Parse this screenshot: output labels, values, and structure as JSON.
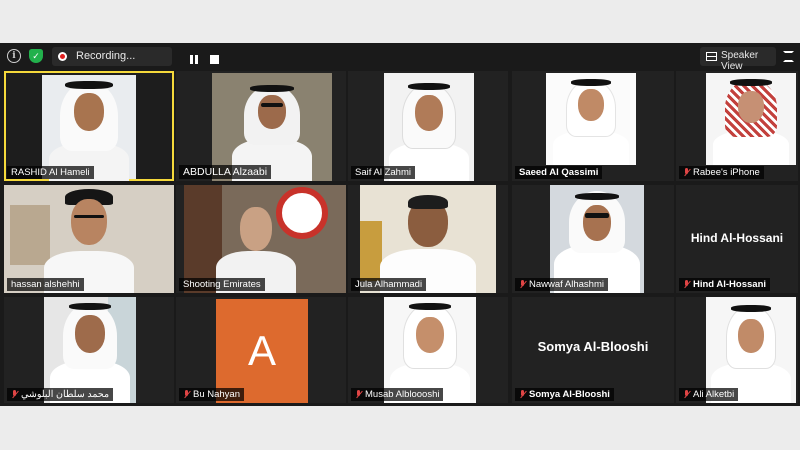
{
  "toolbar": {
    "recording_label": "Recording...",
    "speaker_view_label": "Speaker View",
    "icons": [
      "info-icon",
      "shield-icon",
      "record-icon",
      "pause-icon",
      "stop-icon",
      "grid-icon",
      "fullscreen-icon"
    ],
    "accent": "#f5d93b"
  },
  "participants": [
    {
      "name": "RASHID Al Hameli",
      "muted": false,
      "active_speaker": true
    },
    {
      "name": "ABDULLA Alzaabi",
      "muted": false
    },
    {
      "name": "Saif Al Zahmi",
      "muted": false
    },
    {
      "name": "Saeed Al Qassimi",
      "muted": false
    },
    {
      "name": "Rabee's iPhone",
      "muted": true
    },
    {
      "name": "hassan alshehhi",
      "muted": false
    },
    {
      "name": "Shooting Emirates",
      "muted": false
    },
    {
      "name": "Jula Alhammadi",
      "muted": false
    },
    {
      "name": "Nawwaf Alhashmi",
      "muted": true
    },
    {
      "name": "Hind Al-Hossani",
      "muted": true,
      "video_off": true,
      "center_name": "Hind Al-Hossani"
    },
    {
      "name": "محمد سلطان البلوشي",
      "muted": true
    },
    {
      "name": "Bu Nahyan",
      "muted": true,
      "avatar_letter": "A",
      "avatar_color": "#dd6a2e"
    },
    {
      "name": "Musab Albloooshi",
      "muted": true
    },
    {
      "name": "Somya Al-Blooshi",
      "muted": true,
      "video_off": true,
      "center_name": "Somya Al-Blooshi"
    },
    {
      "name": "Ali Alketbi",
      "muted": true
    }
  ]
}
